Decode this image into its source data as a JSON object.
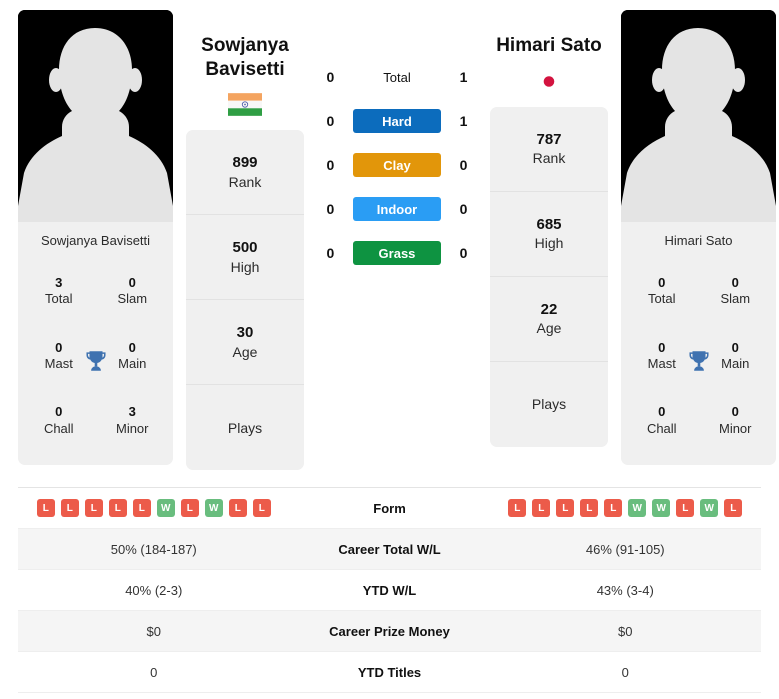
{
  "players": {
    "left": {
      "name_line1": "Sowjanya",
      "name_line2": "Bavisetti",
      "full_name": "Sowjanya Bavisetti",
      "flag": "india-flag",
      "avatar": "player-avatar-placeholder",
      "rank": "899",
      "rank_label": "Rank",
      "high": "500",
      "high_label": "High",
      "age": "30",
      "age_label": "Age",
      "plays": "",
      "plays_label": "Plays",
      "titles": {
        "total": "3",
        "total_label": "Total",
        "slam": "0",
        "slam_label": "Slam",
        "mast": "0",
        "mast_label": "Mast",
        "main": "0",
        "main_label": "Main",
        "chall": "0",
        "chall_label": "Chall",
        "minor": "3",
        "minor_label": "Minor"
      },
      "form": [
        "L",
        "L",
        "L",
        "L",
        "L",
        "W",
        "L",
        "W",
        "L",
        "L"
      ],
      "career_total_wl": "50% (184-187)",
      "ytd_wl": "40% (2-3)",
      "career_prize_money": "$0",
      "ytd_titles": "0"
    },
    "right": {
      "name_line1": "Himari Sato",
      "name_line2": "",
      "full_name": "Himari Sato",
      "flag": "japan-flag",
      "avatar": "player-avatar-placeholder",
      "rank": "787",
      "rank_label": "Rank",
      "high": "685",
      "high_label": "High",
      "age": "22",
      "age_label": "Age",
      "plays": "",
      "plays_label": "Plays",
      "titles": {
        "total": "0",
        "total_label": "Total",
        "slam": "0",
        "slam_label": "Slam",
        "mast": "0",
        "mast_label": "Mast",
        "main": "0",
        "main_label": "Main",
        "chall": "0",
        "chall_label": "Chall",
        "minor": "0",
        "minor_label": "Minor"
      },
      "form": [
        "L",
        "L",
        "L",
        "L",
        "L",
        "W",
        "W",
        "L",
        "W",
        "L"
      ],
      "career_total_wl": "46% (91-105)",
      "ytd_wl": "43% (3-4)",
      "career_prize_money": "$0",
      "ytd_titles": "0"
    }
  },
  "head_to_head": [
    {
      "label": "Total",
      "left": "0",
      "right": "1",
      "color": "none",
      "style": "plain"
    },
    {
      "label": "Hard",
      "left": "0",
      "right": "1",
      "color": "#0c6cbd",
      "style": "pill"
    },
    {
      "label": "Clay",
      "left": "0",
      "right": "0",
      "color": "#e2960a",
      "style": "pill"
    },
    {
      "label": "Indoor",
      "left": "0",
      "right": "0",
      "color": "#2a9df4",
      "style": "pill"
    },
    {
      "label": "Grass",
      "left": "0",
      "right": "0",
      "color": "#0e9341",
      "style": "pill"
    }
  ],
  "table": {
    "form_label": "Form",
    "rows": [
      {
        "label": "Career Total W/L",
        "left": "50% (184-187)",
        "right": "46% (91-105)"
      },
      {
        "label": "YTD W/L",
        "left": "40% (2-3)",
        "right": "43% (3-4)"
      },
      {
        "label": "Career Prize Money",
        "left": "$0",
        "right": "$0"
      },
      {
        "label": "YTD Titles",
        "left": "0",
        "right": "0"
      }
    ]
  },
  "colors": {
    "hard": "#0c6cbd",
    "clay": "#e2960a",
    "indoor": "#2a9df4",
    "grass": "#0e9341",
    "win": "#69bd7e",
    "loss": "#ec5b4a",
    "trophy": "#3f72b0",
    "card_bg": "#f0f0f0"
  }
}
